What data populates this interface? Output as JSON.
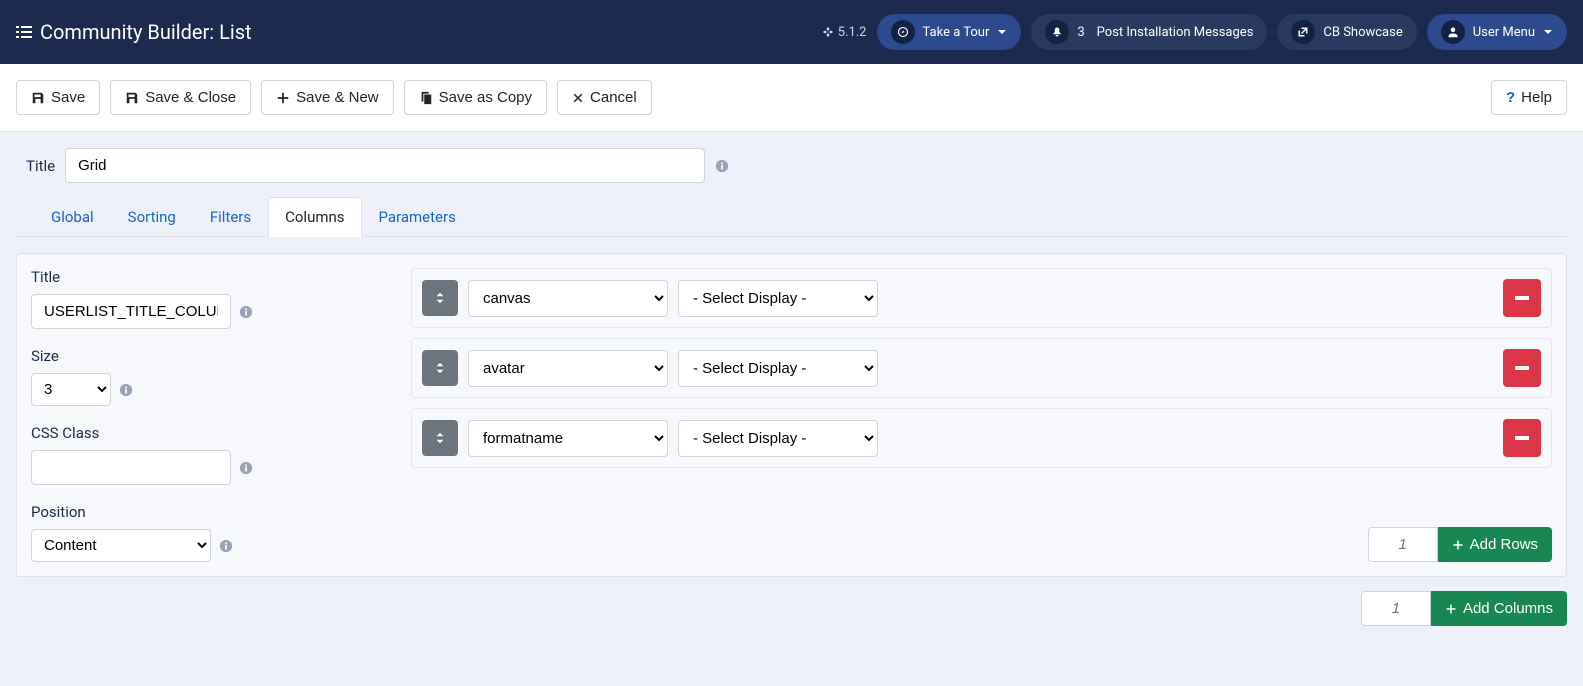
{
  "header": {
    "title": "Community Builder: List",
    "version": "5.1.2",
    "take_tour": "Take a Tour",
    "notif_count": "3",
    "post_install": "Post Installation Messages",
    "showcase": "CB Showcase",
    "user_menu": "User Menu"
  },
  "toolbar": {
    "save": "Save",
    "save_close": "Save & Close",
    "save_new": "Save & New",
    "save_copy": "Save as Copy",
    "cancel": "Cancel",
    "help": "Help"
  },
  "title_field": {
    "label": "Title",
    "value": "Grid"
  },
  "tabs": {
    "global": "Global",
    "sorting": "Sorting",
    "filters": "Filters",
    "columns": "Columns",
    "parameters": "Parameters"
  },
  "left": {
    "title_label": "Title",
    "title_value": "USERLIST_TITLE_COLUMN",
    "size_label": "Size",
    "size_value": "3",
    "css_label": "CSS Class",
    "css_value": "",
    "position_label": "Position",
    "position_value": "Content"
  },
  "rows": [
    {
      "field": "canvas",
      "display": "- Select Display -"
    },
    {
      "field": "avatar",
      "display": "- Select Display -"
    },
    {
      "field": "formatname",
      "display": "- Select Display -"
    }
  ],
  "add_rows": {
    "count": "1",
    "label": "Add Rows"
  },
  "add_columns": {
    "count": "1",
    "label": "Add Columns"
  }
}
